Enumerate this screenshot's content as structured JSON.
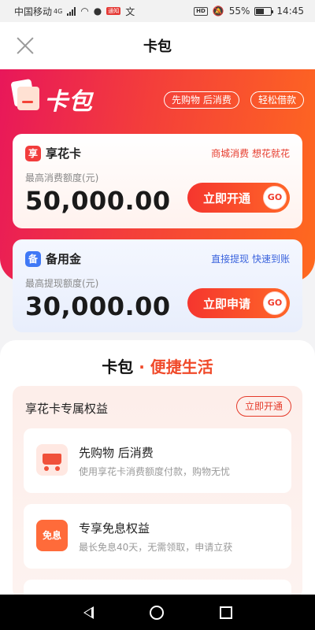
{
  "status_bar": {
    "carrier": "中国移动",
    "network": "4G",
    "extra_icon": "文",
    "badge_text": "通知",
    "hd": "HD",
    "battery": "55%",
    "time": "14:45"
  },
  "nav": {
    "title": "卡包",
    "close_icon": "close-icon"
  },
  "hero": {
    "logo_text": "卡包",
    "tags": [
      "先购物 后消费",
      "轻松借款"
    ]
  },
  "cards": [
    {
      "icon_char": "享",
      "name": "享花卡",
      "slogan": "商城消费 想花就花",
      "limit_label": "最高消费额度(元)",
      "amount": "50,000.00",
      "button": "立即开通",
      "go": "GO"
    },
    {
      "icon_char": "备",
      "name": "备用金",
      "slogan": "直接提现 快速到账",
      "limit_label": "最高提现额度(元)",
      "amount": "30,000.00",
      "button": "立即申请",
      "go": "GO"
    }
  ],
  "section": {
    "title_part1": "卡包",
    "dot": "·",
    "title_part2": "便捷生活"
  },
  "benefits": {
    "title": "享花卡专属权益",
    "button": "立即开通",
    "items": [
      {
        "title": "先购物 后消费",
        "desc": "使用享花卡消费额度付款，购物无忧",
        "icon": "shopping-cart-icon"
      },
      {
        "title": "专享免息权益",
        "desc": "最长免息40天，无需领取，申请立获",
        "icon": "interest-free-icon",
        "icon_text": "免息"
      }
    ]
  },
  "colors": {
    "hero_start": "#e8175a",
    "hero_end": "#ff6a1e",
    "accent": "#f04a2a",
    "blue": "#3f78f6"
  }
}
